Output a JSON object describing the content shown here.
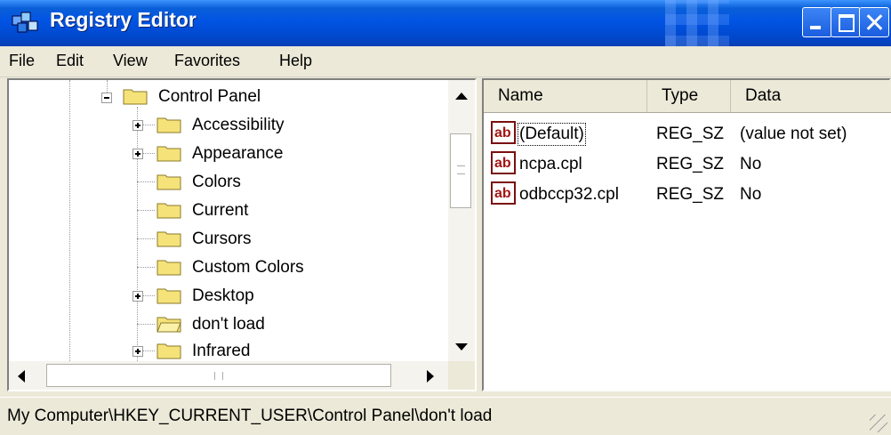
{
  "window": {
    "title": "Registry Editor"
  },
  "menu": [
    "File",
    "Edit",
    "View",
    "Favorites",
    "Help"
  ],
  "tree": {
    "root": {
      "label": "Control Panel",
      "expanded": true
    },
    "children": [
      {
        "label": "Accessibility",
        "expandable": true
      },
      {
        "label": "Appearance",
        "expandable": true
      },
      {
        "label": "Colors",
        "expandable": false
      },
      {
        "label": "Current",
        "expandable": false
      },
      {
        "label": "Cursors",
        "expandable": false
      },
      {
        "label": "Custom Colors",
        "expandable": false
      },
      {
        "label": "Desktop",
        "expandable": true
      },
      {
        "label": "don't load",
        "expandable": false,
        "selected": true
      },
      {
        "label": "Infrared",
        "expandable": true
      }
    ]
  },
  "values": {
    "columns": [
      "Name",
      "Type",
      "Data"
    ],
    "rows": [
      {
        "name": "(Default)",
        "type": "REG_SZ",
        "data": "(value not set)"
      },
      {
        "name": "ncpa.cpl",
        "type": "REG_SZ",
        "data": "No"
      },
      {
        "name": "odbccp32.cpl",
        "type": "REG_SZ",
        "data": "No"
      }
    ]
  },
  "status": {
    "path": "My Computer\\HKEY_CURRENT_USER\\Control Panel\\don't load"
  },
  "colors": {
    "titlebar": "#0054e3",
    "chrome": "#ece9d8",
    "folder": "#f5e37a",
    "ab_icon": "#a31515"
  }
}
